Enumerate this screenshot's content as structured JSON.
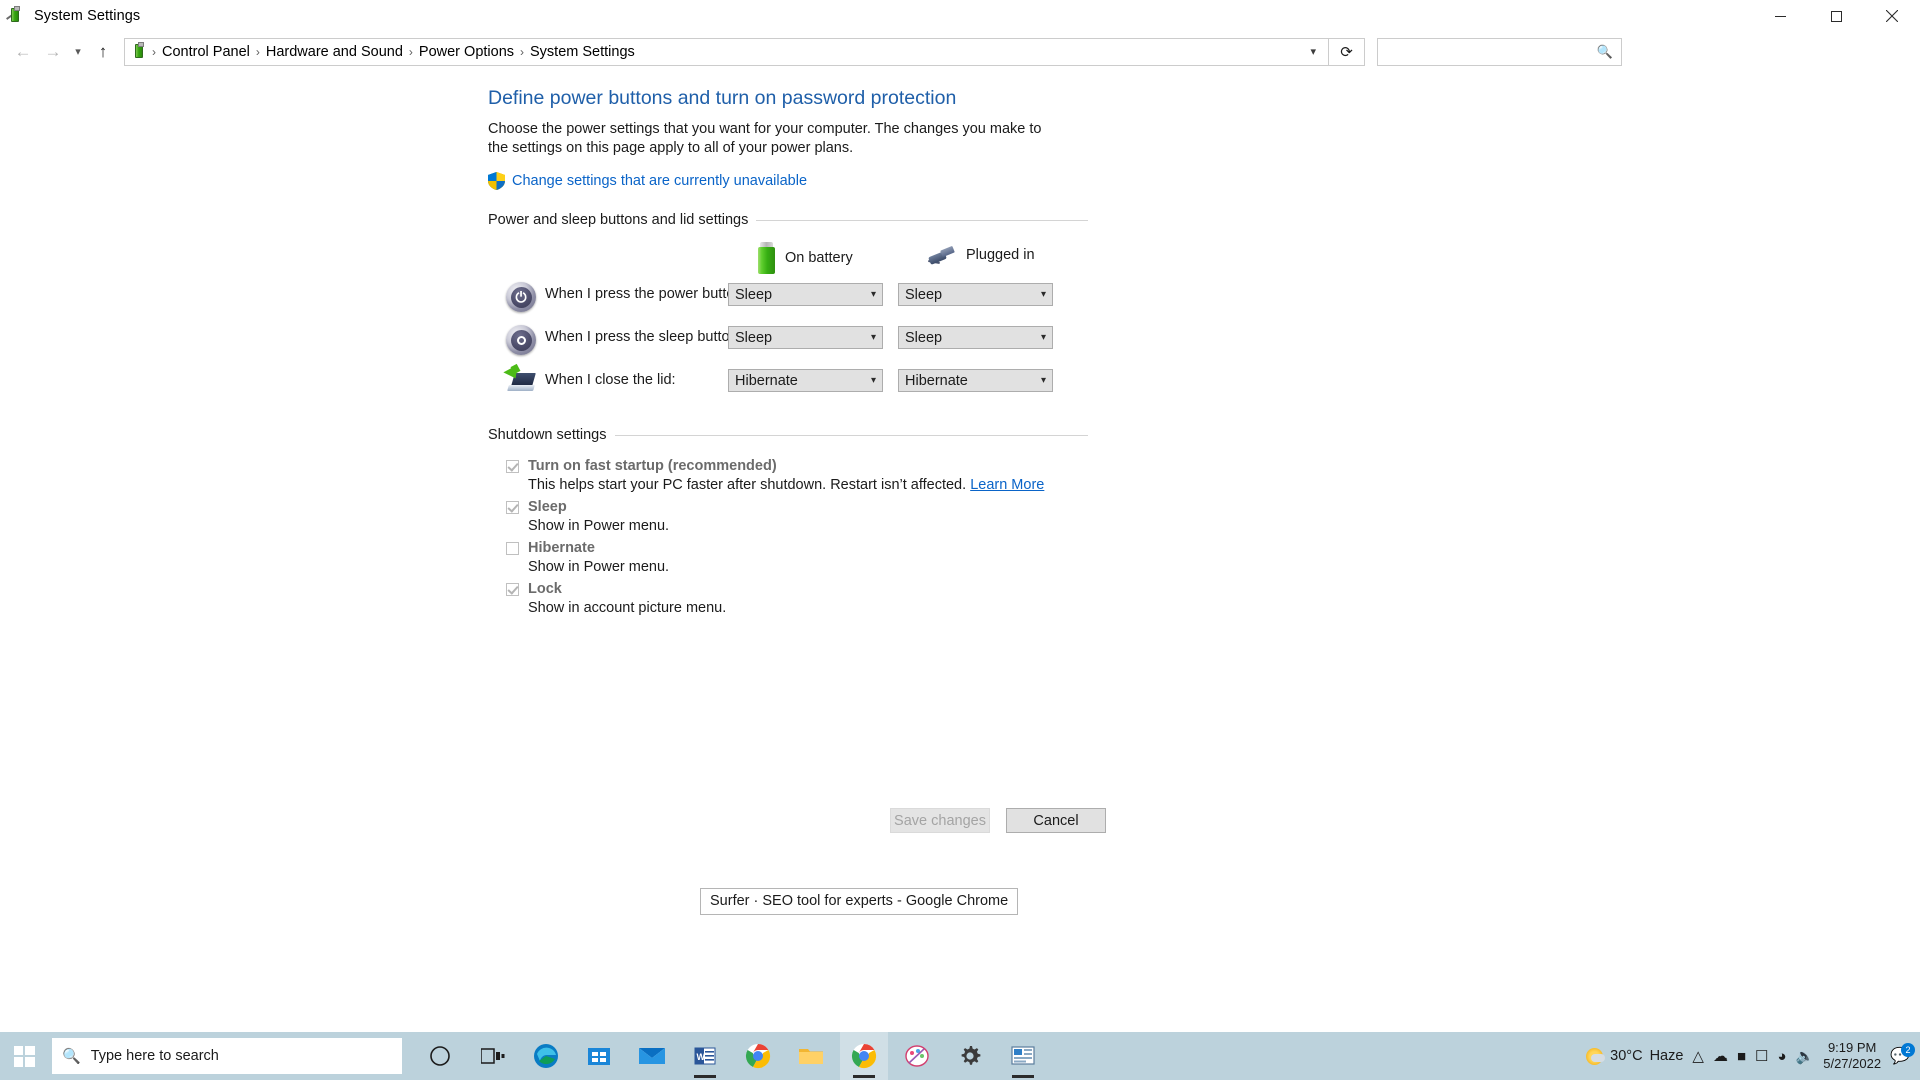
{
  "window": {
    "title": "System Settings",
    "icon": "battery-icon",
    "controls": {
      "minimize": "minimize-icon",
      "maximize": "maximize-icon",
      "close": "close-icon"
    }
  },
  "addressbar": {
    "back_icon": "back-arrow-icon",
    "forward_icon": "forward-arrow-icon",
    "recent_icon": "chevron-down-icon",
    "up_icon": "up-arrow-icon",
    "breadcrumbs": [
      "Control Panel",
      "Hardware and Sound",
      "Power Options",
      "System Settings"
    ],
    "separator": "›",
    "dropdown_icon": "chevron-down-icon",
    "refresh_icon": "refresh-icon",
    "search_placeholder": "",
    "search_value": "",
    "search_icon": "search-icon"
  },
  "page": {
    "title": "Define power buttons and turn on password protection",
    "description": "Choose the power settings that you want for your computer. The changes you make to the settings on this page apply to all of your power plans.",
    "uac_link": "Change settings that are currently unavailable",
    "uac_icon": "shield-icon"
  },
  "power_section": {
    "heading": "Power and sleep buttons and lid settings",
    "columns": [
      {
        "label": "On battery",
        "icon": "battery-icon"
      },
      {
        "label": "Plugged in",
        "icon": "power-plug-icon"
      }
    ],
    "rows": [
      {
        "icon": "power-button-icon",
        "label": "When I press the power button:",
        "on_battery": "Sleep",
        "plugged_in": "Sleep"
      },
      {
        "icon": "sleep-button-icon",
        "label": "When I press the sleep button:",
        "on_battery": "Sleep",
        "plugged_in": "Sleep"
      },
      {
        "icon": "laptop-lid-icon",
        "label": "When I close the lid:",
        "on_battery": "Hibernate",
        "plugged_in": "Hibernate"
      }
    ],
    "dropdown_icon": "chevron-down-icon"
  },
  "shutdown_section": {
    "heading": "Shutdown settings",
    "items": [
      {
        "label": "Turn on fast startup (recommended)",
        "checked": true,
        "description": "This helps start your PC faster after shutdown. Restart isn’t affected.",
        "link": "Learn More"
      },
      {
        "label": "Sleep",
        "checked": true,
        "description": "Show in Power menu.",
        "link": ""
      },
      {
        "label": "Hibernate",
        "checked": false,
        "description": "Show in Power menu.",
        "link": ""
      },
      {
        "label": "Lock",
        "checked": true,
        "description": "Show in account picture menu.",
        "link": ""
      }
    ]
  },
  "buttons": {
    "save": "Save changes",
    "cancel": "Cancel"
  },
  "tooltip": {
    "text": "Surfer · SEO tool for experts - Google Chrome"
  },
  "taskbar": {
    "start_icon": "windows-start-icon",
    "search_placeholder": "Type here to search",
    "search_icon": "search-icon",
    "items": [
      {
        "name": "cortana-icon"
      },
      {
        "name": "task-view-icon"
      },
      {
        "name": "microsoft-edge-icon"
      },
      {
        "name": "microsoft-store-icon"
      },
      {
        "name": "mail-icon"
      },
      {
        "name": "word-icon"
      },
      {
        "name": "google-chrome-icon"
      },
      {
        "name": "file-explorer-icon"
      },
      {
        "name": "chrome-window-icon"
      },
      {
        "name": "paint-icon"
      },
      {
        "name": "settings-icon"
      },
      {
        "name": "control-panel-icon"
      }
    ],
    "tray": {
      "temperature": "30°C",
      "weather": "Haze",
      "weather_icon": "haze-icon",
      "overflow_icon": "chevron-up-icon",
      "onedrive_icon": "onedrive-icon",
      "battery_icon": "battery-icon",
      "display_icon": "display-icon",
      "network_icon": "wifi-icon",
      "volume_icon": "volume-icon",
      "time": "9:19 PM",
      "date": "5/27/2022",
      "notification_icon": "notification-icon",
      "notification_count": "2"
    }
  },
  "colors": {
    "accent": "#0a64c8",
    "title_blue": "#1f5fa9",
    "taskbar": "#bcd2dc",
    "combo_bg": "#e1e1e1"
  }
}
